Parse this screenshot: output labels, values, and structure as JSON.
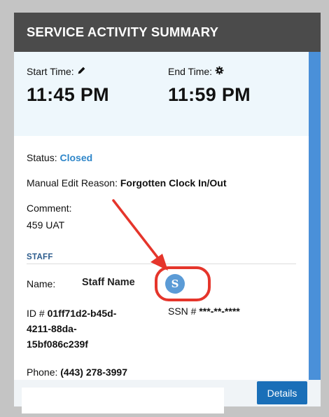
{
  "header": {
    "title": "SERVICE ACTIVITY SUMMARY"
  },
  "times": {
    "start_label": "Start Time:",
    "start_icon": "pencil-icon",
    "start_value": "11:45 PM",
    "end_label": "End Time:",
    "end_icon": "gear-icon",
    "end_value": "11:59 PM"
  },
  "status": {
    "label": "Status:",
    "value": "Closed",
    "value_color": "#2e86c9"
  },
  "manual_edit": {
    "label": "Manual Edit Reason:",
    "value": "Forgotten Clock In/Out"
  },
  "comment": {
    "label": "Comment:",
    "value": "459 UAT"
  },
  "staff": {
    "section_title": "STAFF",
    "name_label": "Name:",
    "name_value": "Staff Name",
    "avatar_initial": "S",
    "id_label": "ID #",
    "id_value_lines": [
      "01ff71d2-b45d-",
      "4211-88da-",
      "15bf086c239f"
    ],
    "ssn_label": "SSN #",
    "ssn_value": "***-**-****",
    "phone_label": "Phone:",
    "phone_value": "(443) 278-3997"
  },
  "footer": {
    "details_label": "Details"
  },
  "colors": {
    "header_bg": "#4b4b4b",
    "accent": "#1a6fb8",
    "annotation": "#e5352b"
  }
}
